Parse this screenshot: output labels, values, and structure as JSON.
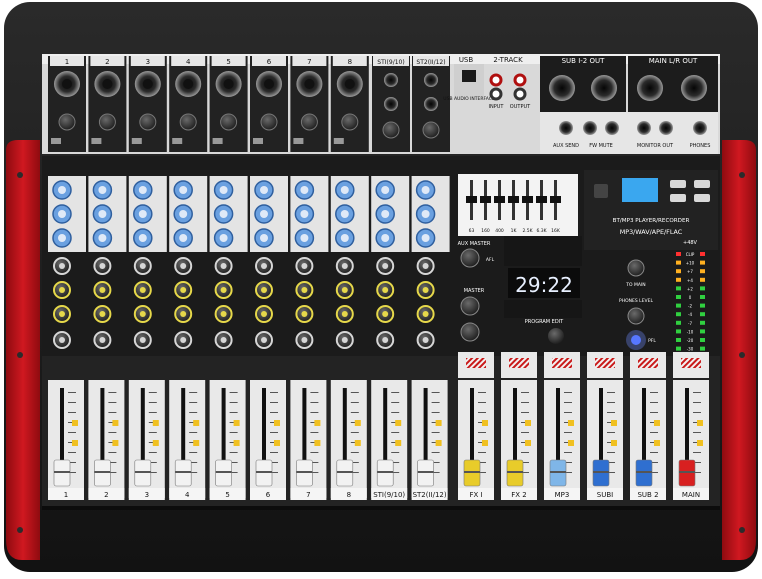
{
  "io_panel": {
    "channel_numbers": [
      "1",
      "2",
      "3",
      "4",
      "5",
      "6",
      "7",
      "8"
    ],
    "stereo_labels": [
      "STI(9/10)",
      "ST2(II/12)"
    ],
    "usb_label": "USB",
    "usb_caption": "USB AUDIO INTERFACE",
    "two_track_label": "2-TRACK",
    "two_track_input": "INPUT",
    "two_track_output": "OUTPUT",
    "sub_out_label": "SUB I-2 OUT",
    "main_out_label": "MAIN L/R OUT",
    "aux_send_label": "AUX SEND",
    "fw_mute_label": "FW MUTE",
    "monitor_out_label": "MONITOR OUT",
    "phones_label": "PHONES"
  },
  "channel_strip_labels": [
    "1",
    "2",
    "3",
    "4",
    "5",
    "6",
    "7",
    "8",
    "STI(9/10)",
    "ST2(II/12)"
  ],
  "master_strip_labels": [
    "FX I",
    "FX 2",
    "MP3",
    "SUBI",
    "SUB 2",
    "MAIN"
  ],
  "player": {
    "title": "BT/MP3 PLAYER/RECORDER",
    "formats": "MP3/WAV/APE/FLAC",
    "time": "29:22",
    "program_label": "PROGRAM EDIT"
  },
  "eq_bands": [
    "63",
    "160",
    "400",
    "1K",
    "2.5K",
    "6.3K",
    "16K"
  ],
  "master_section": {
    "aux_master": "AUX MASTER",
    "master": "MASTER",
    "afl": "AFL",
    "to_main": "TO MAIN",
    "phones_level": "PHONES LEVEL",
    "pfl": "PFL",
    "phantom": "+48V"
  },
  "meter_scale": [
    "CLIP",
    "+10",
    "+7",
    "+4",
    "+2",
    "0",
    "-2",
    "-4",
    "-7",
    "-10",
    "-20",
    "-30"
  ],
  "colors": {
    "body": "#1d1d1d",
    "red_side": "#c8141a",
    "panel_light": "#e8e8e8",
    "knob_blue": "#5b8fd3",
    "knob_yellow": "#e6d84a",
    "fader_white": "#f2f2f2",
    "fader_yellow": "#e8cc2a",
    "fader_lightblue": "#7fb6e8",
    "fader_blue": "#2f6fd0",
    "fader_red": "#d82020"
  }
}
